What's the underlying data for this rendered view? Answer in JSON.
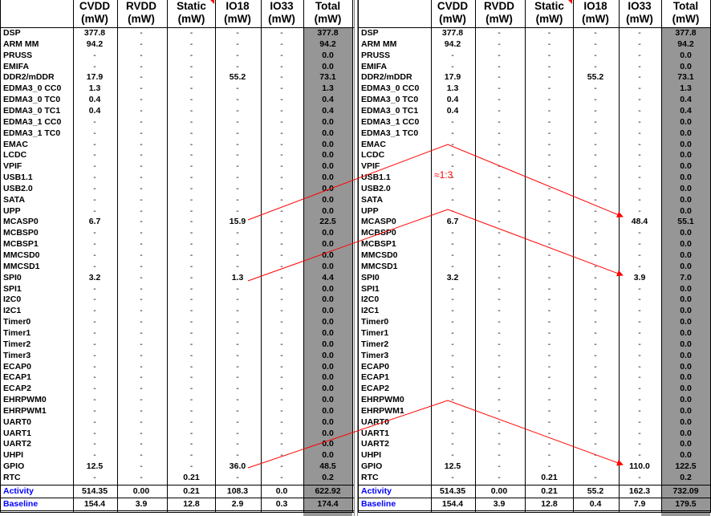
{
  "headers": [
    {
      "line1": "CVDD",
      "line2": "(mW)"
    },
    {
      "line1": "RVDD",
      "line2": "(mW)"
    },
    {
      "line1": "Static",
      "line2": "(mW)"
    },
    {
      "line1": "IO18",
      "line2": "(mW)"
    },
    {
      "line1": "IO33",
      "line2": "(mW)"
    },
    {
      "line1": "Total",
      "line2": "(mW)"
    }
  ],
  "left_table": {
    "rows": [
      [
        "DSP",
        "377.8",
        "-",
        "-",
        "-",
        "-",
        "377.8"
      ],
      [
        "ARM MM",
        "94.2",
        "-",
        "-",
        "-",
        "-",
        "94.2"
      ],
      [
        "PRUSS",
        "-",
        "-",
        "-",
        "-",
        "-",
        "0.0"
      ],
      [
        "EMIFA",
        "-",
        "-",
        "-",
        "-",
        "-",
        "0.0"
      ],
      [
        "DDR2/mDDR",
        "17.9",
        "-",
        "-",
        "55.2",
        "-",
        "73.1"
      ],
      [
        "EDMA3_0 CC0",
        "1.3",
        "-",
        "-",
        "-",
        "-",
        "1.3"
      ],
      [
        "EDMA3_0 TC0",
        "0.4",
        "-",
        "-",
        "-",
        "-",
        "0.4"
      ],
      [
        "EDMA3_0 TC1",
        "0.4",
        "-",
        "-",
        "-",
        "-",
        "0.4"
      ],
      [
        "EDMA3_1 CC0",
        "-",
        "-",
        "-",
        "-",
        "-",
        "0.0"
      ],
      [
        "EDMA3_1 TC0",
        "-",
        "-",
        "-",
        "-",
        "-",
        "0.0"
      ],
      [
        "EMAC",
        "-",
        "-",
        "-",
        "-",
        "-",
        "0.0"
      ],
      [
        "LCDC",
        "-",
        "-",
        "-",
        "-",
        "-",
        "0.0"
      ],
      [
        "VPIF",
        "-",
        "-",
        "-",
        "-",
        "-",
        "0.0"
      ],
      [
        "USB1.1",
        "-",
        "-",
        "-",
        "-",
        "-",
        "0.0"
      ],
      [
        "USB2.0",
        "-",
        "-",
        "-",
        "-",
        "-",
        "0.0"
      ],
      [
        "SATA",
        "-",
        "-",
        "-",
        "-",
        "-",
        "0.0"
      ],
      [
        "UPP",
        "-",
        "-",
        "-",
        "-",
        "-",
        "0.0"
      ],
      [
        "MCASP0",
        "6.7",
        "-",
        "-",
        "15.9",
        "-",
        "22.5"
      ],
      [
        "MCBSP0",
        "-",
        "-",
        "-",
        "-",
        "-",
        "0.0"
      ],
      [
        "MCBSP1",
        "-",
        "-",
        "-",
        "-",
        "-",
        "0.0"
      ],
      [
        "MMCSD0",
        "-",
        "-",
        "-",
        "-",
        "-",
        "0.0"
      ],
      [
        "MMCSD1",
        "-",
        "-",
        "-",
        "-",
        "-",
        "0.0"
      ],
      [
        "SPI0",
        "3.2",
        "-",
        "-",
        "1.3",
        "-",
        "4.4"
      ],
      [
        "SPI1",
        "-",
        "-",
        "-",
        "-",
        "-",
        "0.0"
      ],
      [
        "I2C0",
        "-",
        "-",
        "-",
        "-",
        "-",
        "0.0"
      ],
      [
        "I2C1",
        "-",
        "-",
        "-",
        "-",
        "-",
        "0.0"
      ],
      [
        "Timer0",
        "-",
        "-",
        "-",
        "-",
        "-",
        "0.0"
      ],
      [
        "Timer1",
        "-",
        "-",
        "-",
        "-",
        "-",
        "0.0"
      ],
      [
        "Timer2",
        "-",
        "-",
        "-",
        "-",
        "-",
        "0.0"
      ],
      [
        "Timer3",
        "-",
        "-",
        "-",
        "-",
        "-",
        "0.0"
      ],
      [
        "ECAP0",
        "-",
        "-",
        "-",
        "-",
        "-",
        "0.0"
      ],
      [
        "ECAP1",
        "-",
        "-",
        "-",
        "-",
        "-",
        "0.0"
      ],
      [
        "ECAP2",
        "-",
        "-",
        "-",
        "-",
        "-",
        "0.0"
      ],
      [
        "EHRPWM0",
        "-",
        "-",
        "-",
        "-",
        "-",
        "0.0"
      ],
      [
        "EHRPWM1",
        "-",
        "-",
        "-",
        "-",
        "-",
        "0.0"
      ],
      [
        "UART0",
        "-",
        "-",
        "-",
        "-",
        "-",
        "0.0"
      ],
      [
        "UART1",
        "-",
        "-",
        "-",
        "-",
        "-",
        "0.0"
      ],
      [
        "UART2",
        "-",
        "-",
        "-",
        "-",
        "-",
        "0.0"
      ],
      [
        "UHPI",
        "-",
        "-",
        "-",
        "-",
        "-",
        "0.0"
      ],
      [
        "GPIO",
        "12.5",
        "-",
        "-",
        "36.0",
        "-",
        "48.5"
      ],
      [
        "RTC",
        "-",
        "-",
        "0.21",
        "-",
        "-",
        "0.2"
      ]
    ],
    "activity": [
      "Activity",
      "514.35",
      "0.00",
      "0.21",
      "108.3",
      "0.0",
      "622.92"
    ],
    "baseline": [
      "Baseline",
      "154.4",
      "3.9",
      "12.8",
      "2.9",
      "0.3",
      "174.4"
    ]
  },
  "right_table": {
    "rows": [
      [
        "DSP",
        "377.8",
        "-",
        "-",
        "-",
        "-",
        "377.8"
      ],
      [
        "ARM MM",
        "94.2",
        "-",
        "-",
        "-",
        "-",
        "94.2"
      ],
      [
        "PRUSS",
        "-",
        "-",
        "-",
        "-",
        "-",
        "0.0"
      ],
      [
        "EMIFA",
        "-",
        "-",
        "-",
        "-",
        "-",
        "0.0"
      ],
      [
        "DDR2/mDDR",
        "17.9",
        "-",
        "-",
        "55.2",
        "-",
        "73.1"
      ],
      [
        "EDMA3_0 CC0",
        "1.3",
        "-",
        "-",
        "-",
        "-",
        "1.3"
      ],
      [
        "EDMA3_0 TC0",
        "0.4",
        "-",
        "-",
        "-",
        "-",
        "0.4"
      ],
      [
        "EDMA3_0 TC1",
        "0.4",
        "-",
        "-",
        "-",
        "-",
        "0.4"
      ],
      [
        "EDMA3_1 CC0",
        "-",
        "-",
        "-",
        "-",
        "-",
        "0.0"
      ],
      [
        "EDMA3_1 TC0",
        "-",
        "-",
        "-",
        "-",
        "-",
        "0.0"
      ],
      [
        "EMAC",
        "-",
        "-",
        "-",
        "-",
        "-",
        "0.0"
      ],
      [
        "LCDC",
        "-",
        "-",
        "-",
        "-",
        "-",
        "0.0"
      ],
      [
        "VPIF",
        "-",
        "-",
        "-",
        "-",
        "-",
        "0.0"
      ],
      [
        "USB1.1",
        "-",
        "-",
        "-",
        "-",
        "-",
        "0.0"
      ],
      [
        "USB2.0",
        "-",
        "-",
        "-",
        "-",
        "-",
        "0.0"
      ],
      [
        "SATA",
        "-",
        "-",
        "-",
        "-",
        "-",
        "0.0"
      ],
      [
        "UPP",
        "-",
        "-",
        "-",
        "-",
        "-",
        "0.0"
      ],
      [
        "MCASP0",
        "6.7",
        "-",
        "-",
        "-",
        "48.4",
        "55.1"
      ],
      [
        "MCBSP0",
        "-",
        "-",
        "-",
        "-",
        "-",
        "0.0"
      ],
      [
        "MCBSP1",
        "-",
        "-",
        "-",
        "-",
        "-",
        "0.0"
      ],
      [
        "MMCSD0",
        "-",
        "-",
        "-",
        "-",
        "-",
        "0.0"
      ],
      [
        "MMCSD1",
        "-",
        "-",
        "-",
        "-",
        "-",
        "0.0"
      ],
      [
        "SPI0",
        "3.2",
        "-",
        "-",
        "-",
        "3.9",
        "7.0"
      ],
      [
        "SPI1",
        "-",
        "-",
        "-",
        "-",
        "-",
        "0.0"
      ],
      [
        "I2C0",
        "-",
        "-",
        "-",
        "-",
        "-",
        "0.0"
      ],
      [
        "I2C1",
        "-",
        "-",
        "-",
        "-",
        "-",
        "0.0"
      ],
      [
        "Timer0",
        "-",
        "-",
        "-",
        "-",
        "-",
        "0.0"
      ],
      [
        "Timer1",
        "-",
        "-",
        "-",
        "-",
        "-",
        "0.0"
      ],
      [
        "Timer2",
        "-",
        "-",
        "-",
        "-",
        "-",
        "0.0"
      ],
      [
        "Timer3",
        "-",
        "-",
        "-",
        "-",
        "-",
        "0.0"
      ],
      [
        "ECAP0",
        "-",
        "-",
        "-",
        "-",
        "-",
        "0.0"
      ],
      [
        "ECAP1",
        "-",
        "-",
        "-",
        "-",
        "-",
        "0.0"
      ],
      [
        "ECAP2",
        "-",
        "-",
        "-",
        "-",
        "-",
        "0.0"
      ],
      [
        "EHRPWM0",
        "-",
        "-",
        "-",
        "-",
        "-",
        "0.0"
      ],
      [
        "EHRPWM1",
        "-",
        "-",
        "-",
        "-",
        "-",
        "0.0"
      ],
      [
        "UART0",
        "-",
        "-",
        "-",
        "-",
        "-",
        "0.0"
      ],
      [
        "UART1",
        "-",
        "-",
        "-",
        "-",
        "-",
        "0.0"
      ],
      [
        "UART2",
        "-",
        "-",
        "-",
        "-",
        "-",
        "0.0"
      ],
      [
        "UHPI",
        "-",
        "-",
        "-",
        "-",
        "-",
        "0.0"
      ],
      [
        "GPIO",
        "12.5",
        "-",
        "-",
        "-",
        "110.0",
        "122.5"
      ],
      [
        "RTC",
        "-",
        "-",
        "0.21",
        "-",
        "-",
        "0.2"
      ]
    ],
    "activity": [
      "Activity",
      "514.35",
      "0.00",
      "0.21",
      "55.2",
      "162.3",
      "732.09"
    ],
    "baseline": [
      "Baseline",
      "154.4",
      "3.9",
      "12.8",
      "0.4",
      "7.9",
      "179.5"
    ]
  },
  "annotation": "≈1:3",
  "colors": {
    "total_column": "#969696",
    "summary_label": "#0000ff",
    "annotation": "#ff0000",
    "grid": "#000000"
  }
}
